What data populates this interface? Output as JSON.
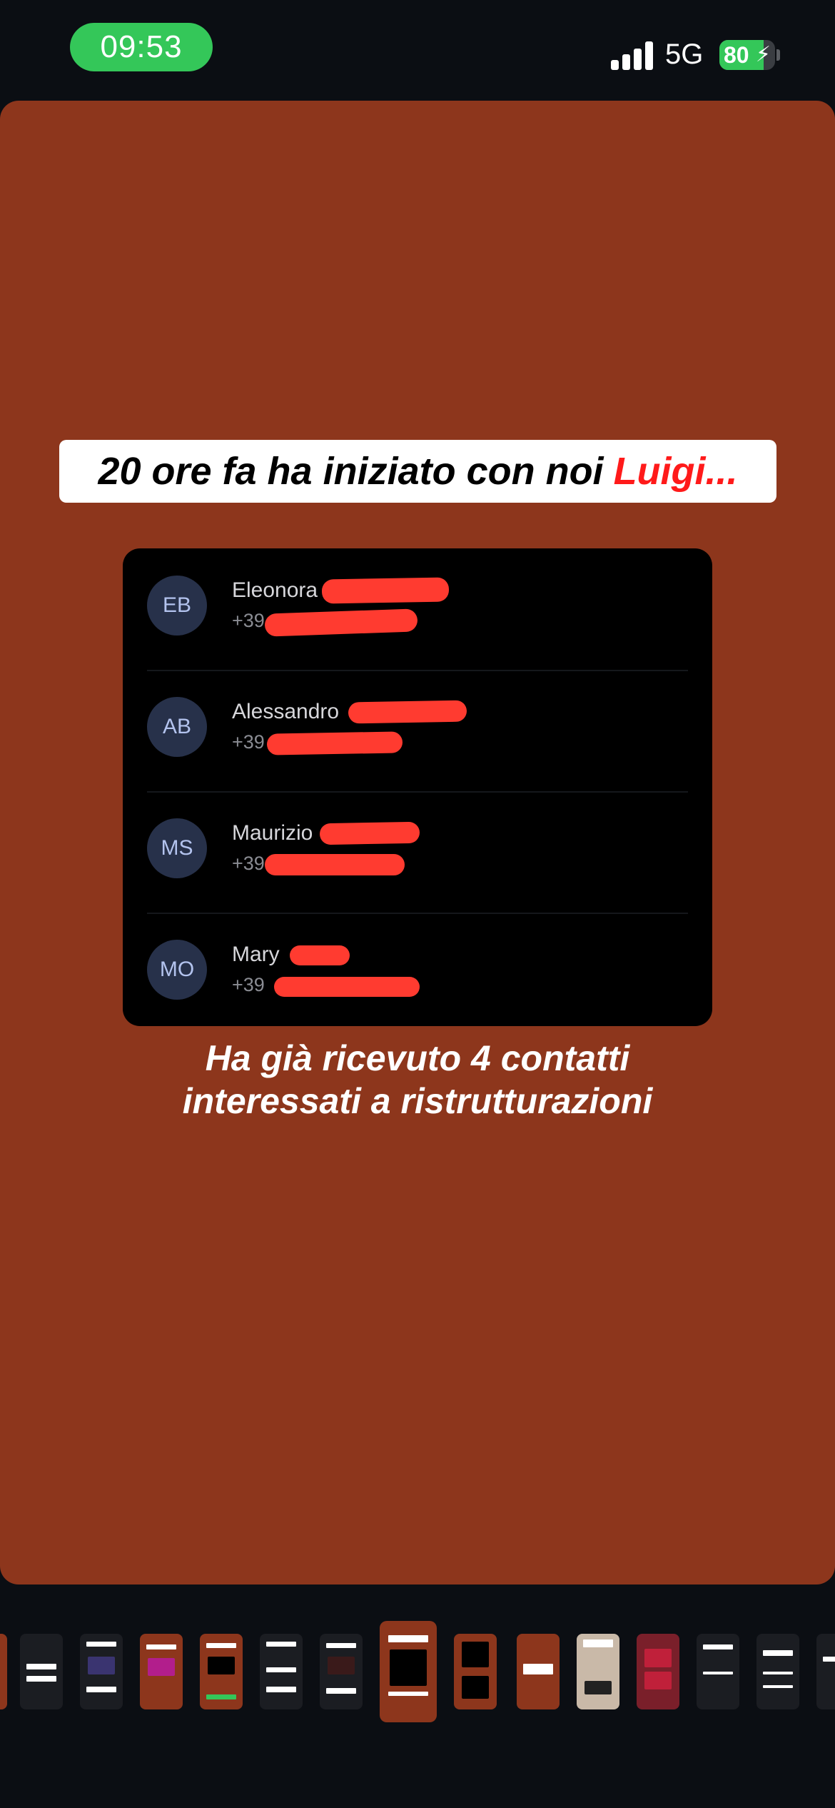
{
  "status_bar": {
    "time": "09:53",
    "network": "5G",
    "battery_level": "80",
    "battery_fraction": 0.8,
    "colors": {
      "time_pill": "#34c759",
      "battery": "#34c759"
    }
  },
  "story": {
    "background_color": "#8d361c",
    "headline": {
      "text": "20 ore fa ha iniziato con noi",
      "accent": "Luigi...",
      "accent_color": "#ff1a1a"
    },
    "contacts": [
      {
        "initials": "EB",
        "name": "Eleonora",
        "phone": "+39"
      },
      {
        "initials": "AB",
        "name": "Alessandro",
        "phone": "+39"
      },
      {
        "initials": "MS",
        "name": "Maurizio",
        "phone": "+39"
      },
      {
        "initials": "MO",
        "name": "Mary",
        "phone": "+39"
      }
    ],
    "caption_line1": "Ha già ricevuto 4 contatti",
    "caption_line2": "interessati a ristrutturazioni"
  },
  "thumbnails": {
    "count": 15,
    "current_index": 6,
    "icons": [
      "battery-bolt-icon",
      "signal-icon"
    ]
  }
}
